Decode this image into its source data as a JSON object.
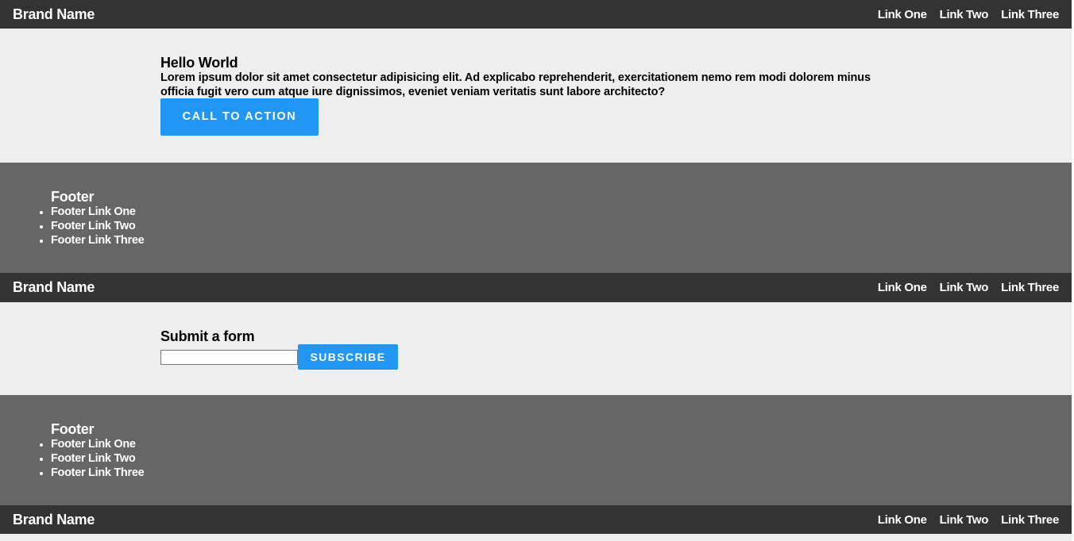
{
  "nav": {
    "brand": "Brand Name",
    "links": [
      "Link One",
      "Link Two",
      "Link Three"
    ]
  },
  "hero": {
    "title": "Hello World",
    "body": "Lorem ipsum dolor sit amet consectetur adipisicing elit. Ad explicabo reprehenderit, exercitationem nemo rem modi dolorem minus officia fugit vero cum atque iure dignissimos, eveniet veniam veritatis sunt labore architecto?",
    "cta_label": "CALL TO ACTION"
  },
  "footer": {
    "title": "Footer",
    "links": [
      "Footer Link One",
      "Footer Link Two",
      "Footer Link Three"
    ]
  },
  "form": {
    "title": "Submit a form",
    "input_value": "",
    "submit_label": "SUBSCRIBE"
  },
  "colors": {
    "nav_bg": "#333333",
    "footer_bg": "#666666",
    "page_bg": "#eeeeee",
    "accent": "#2196f3"
  }
}
